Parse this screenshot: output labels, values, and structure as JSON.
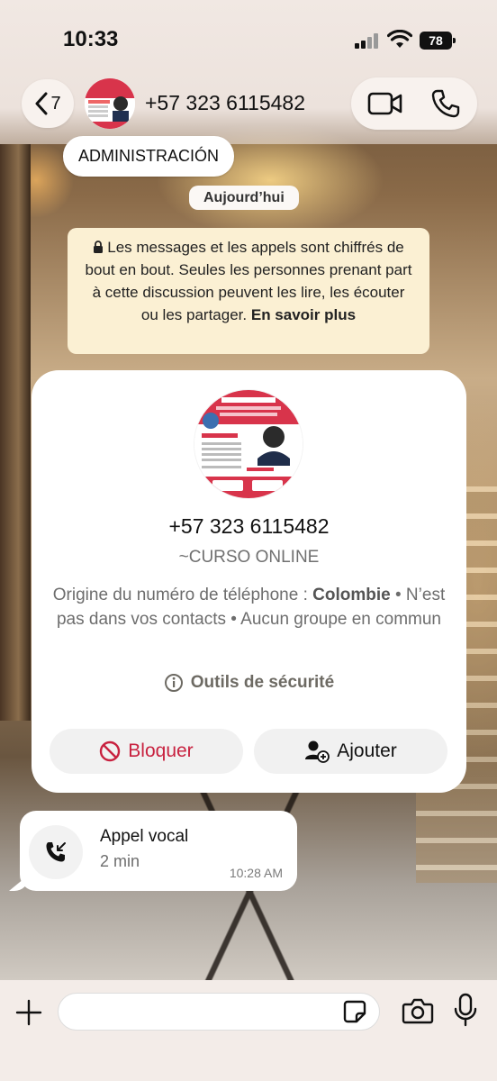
{
  "status_bar": {
    "time": "10:33",
    "battery": "78"
  },
  "header": {
    "back_count": "7",
    "title": "+57 323 6115482",
    "role_badge": "ADMINISTRACIÓN"
  },
  "chat": {
    "date_chip": "Aujourd’hui",
    "encryption_notice": {
      "text": "Les messages et les appels sont chiffrés de bout en bout. Seules les personnes prenant part à cette discussion peuvent les lire, les écouter ou les partager.",
      "link": "En savoir plus"
    },
    "contact_card": {
      "number": "+57 323 6115482",
      "name": "~CURSO ONLINE",
      "origin_label": "Origine du numéro de téléphone :",
      "origin_country": "Colombie",
      "origin_rest": "• N’est pas dans vos contacts • Aucun groupe en commun",
      "safety_tools": "Outils de sécurité",
      "block_label": "Bloquer",
      "add_label": "Ajouter"
    },
    "call_message": {
      "title": "Appel vocal",
      "duration": "2 min",
      "time": "10:28 AM"
    }
  },
  "input": {
    "placeholder": "",
    "value": ""
  },
  "colors": {
    "block_red": "#c8213f",
    "notice_yellow": "#fbf0d3"
  }
}
